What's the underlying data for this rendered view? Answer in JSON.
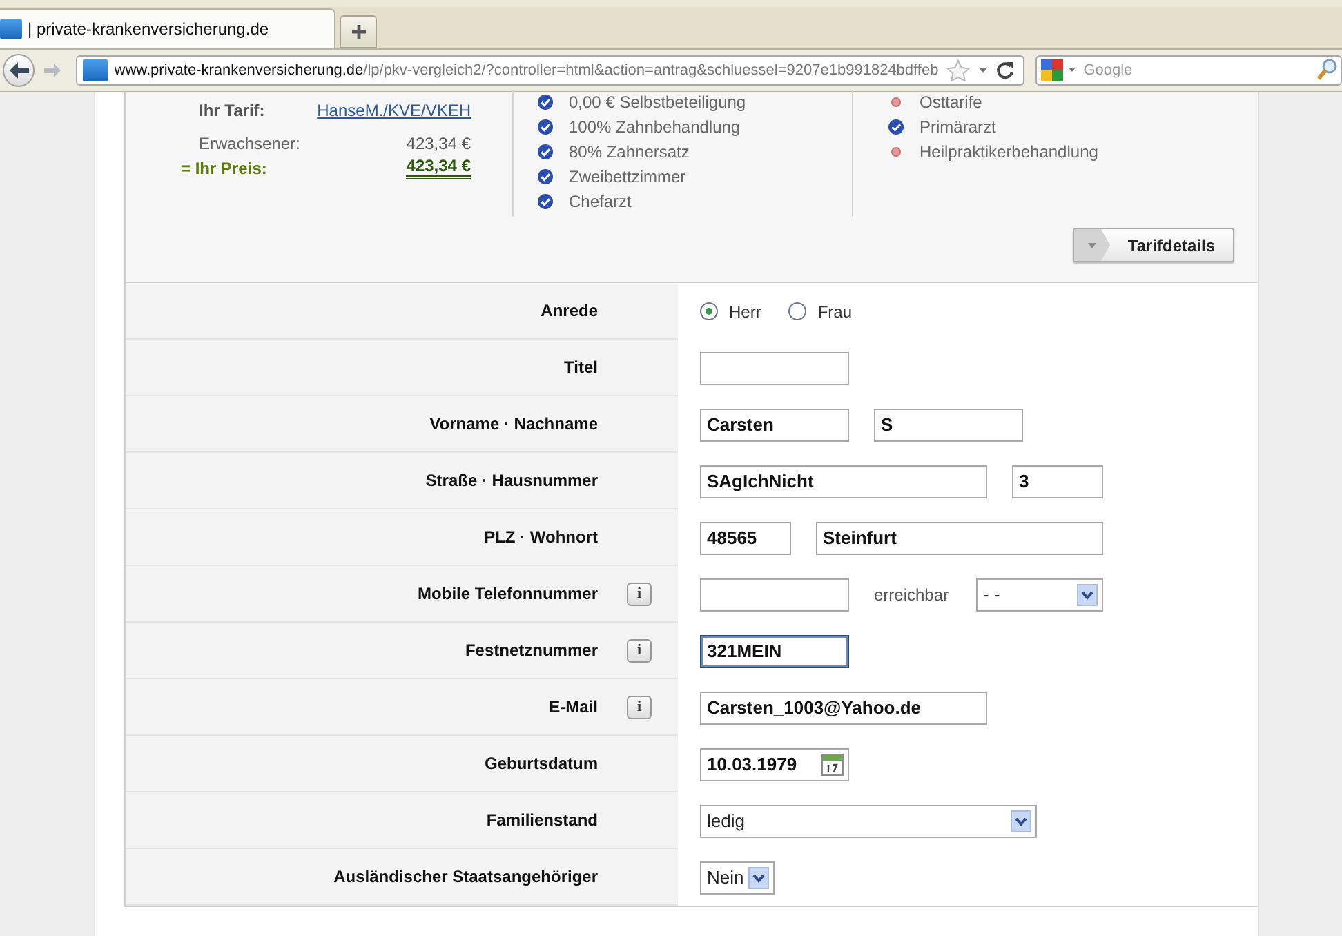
{
  "browser": {
    "tab_title": "| private-krankenversicherung.de",
    "url_host": "www.private-krankenversicherung.de",
    "url_path": "/lp/pkv-vergleich2/?controller=html&action=antrag&schluessel=9207e1b991824bdffeb",
    "search_placeholder": "Google"
  },
  "tariff": {
    "tarif_label": "Ihr Tarif:",
    "tarif_link": "HanseM./KVE/VKEH",
    "adult_label": "Erwachsener:",
    "adult_price": "423,34 €",
    "price_label": "= Ihr Preis:",
    "price": "423,34 €",
    "features": [
      {
        "text": "0,00 € Selbstbeteiligung",
        "included": true
      },
      {
        "text": "100% Zahnbehandlung",
        "included": true
      },
      {
        "text": "80% Zahnersatz",
        "included": true
      },
      {
        "text": "Zweibettzimmer",
        "included": true
      },
      {
        "text": "Chefarzt",
        "included": true
      }
    ],
    "features_2": [
      {
        "text": "Osttarife",
        "included": false
      },
      {
        "text": "Primärarzt",
        "included": true
      },
      {
        "text": "Heilpraktikerbehandlung",
        "included": false
      }
    ],
    "details_button": "Tarifdetails"
  },
  "form": {
    "rows": [
      {
        "label": "Anrede",
        "items": [
          {
            "kind": "radio",
            "label": "Herr",
            "selected": true
          },
          {
            "kind": "radio",
            "label": "Frau",
            "selected": false
          }
        ]
      },
      {
        "label": "Titel",
        "items": [
          {
            "kind": "input",
            "focused": false
          }
        ]
      },
      {
        "label": "Vorname · Nachname",
        "items": [
          {
            "kind": "input",
            "value": "Carsten",
            "focused": false
          },
          {
            "kind": "input",
            "value": "S",
            "focused": false
          }
        ]
      },
      {
        "label": "Straße · Hausnummer",
        "items": [
          {
            "kind": "input",
            "value": "SAgIchNicht",
            "focused": false
          },
          {
            "kind": "input",
            "value": "3",
            "focused": false
          }
        ]
      },
      {
        "label": "PLZ · Wohnort",
        "items": [
          {
            "kind": "input",
            "value": "48565",
            "focused": false
          },
          {
            "kind": "input",
            "value": "Steinfurt",
            "focused": false
          }
        ]
      },
      {
        "label": "Mobile Telefonnummer",
        "info": "i",
        "items": [
          {
            "kind": "input",
            "focused": false
          },
          {
            "kind": "text",
            "value": "erreichbar"
          },
          {
            "kind": "select",
            "value": "- -"
          }
        ]
      },
      {
        "label": "Festnetznummer",
        "info": "i",
        "items": [
          {
            "kind": "input",
            "value": "321MEIN",
            "focused": true
          }
        ]
      },
      {
        "label": "E-Mail",
        "info": "i",
        "items": [
          {
            "kind": "input",
            "value": "Carsten_1003@Yahoo.de",
            "focused": false
          }
        ]
      },
      {
        "label": "Geburtsdatum",
        "items": [
          {
            "kind": "date",
            "value": "10.03.1979"
          }
        ]
      },
      {
        "label": "Familienstand",
        "items": [
          {
            "kind": "select",
            "value": "ledig"
          }
        ]
      },
      {
        "label": "Ausländischer Staatsangehöriger",
        "items": [
          {
            "kind": "select",
            "value": "Nein"
          }
        ]
      }
    ]
  }
}
